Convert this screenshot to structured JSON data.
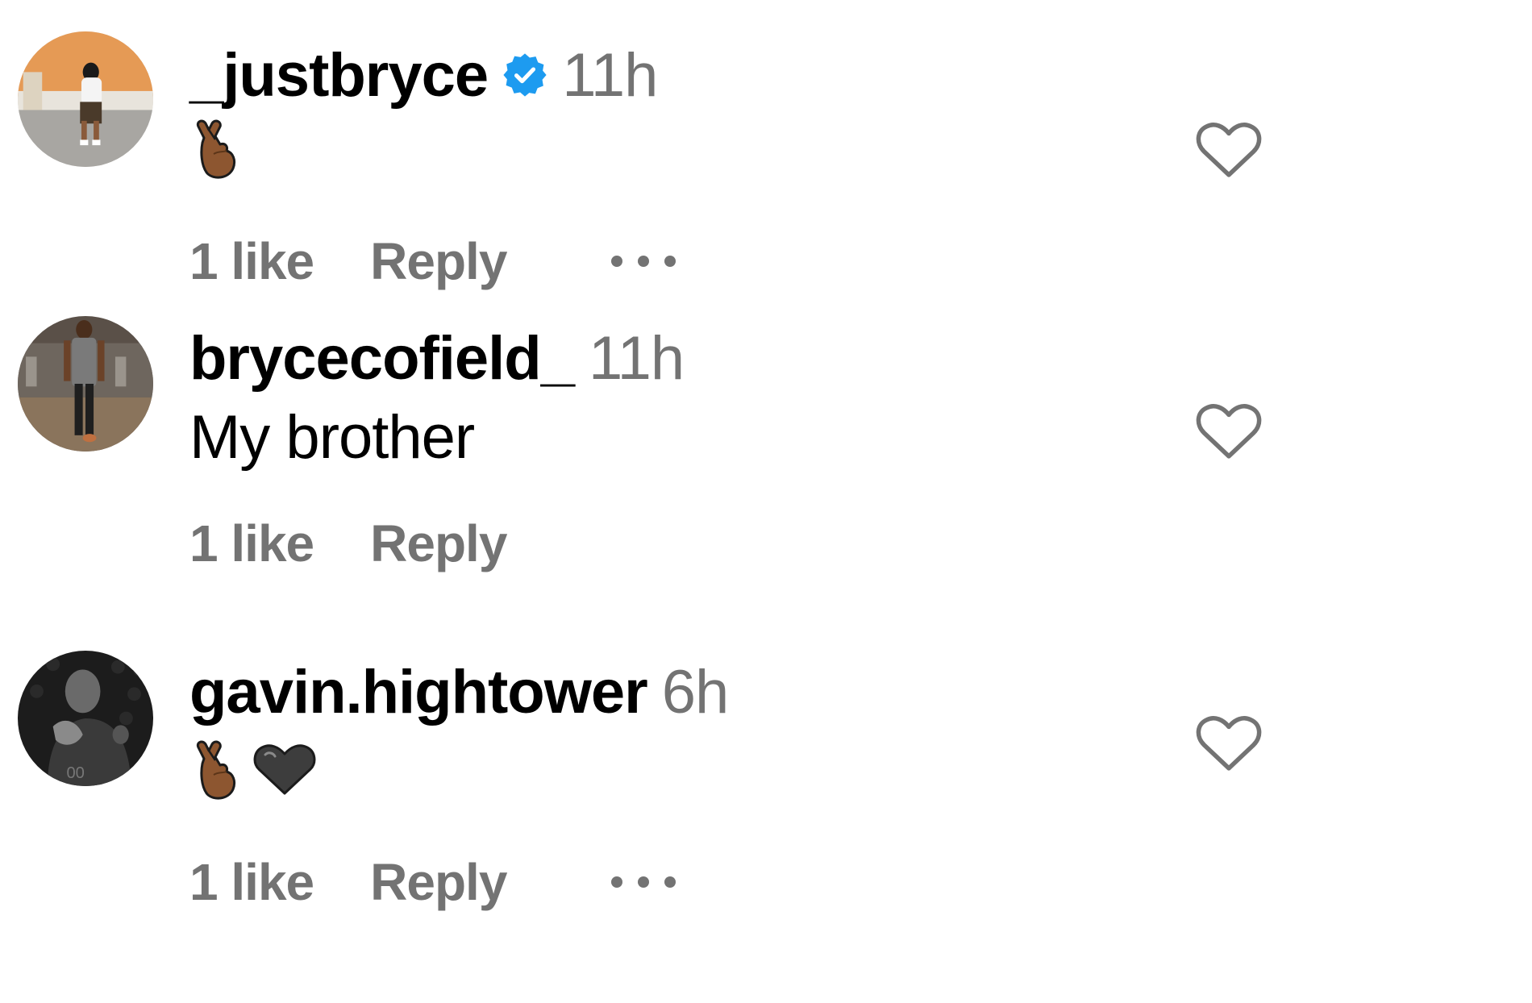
{
  "colors": {
    "username": "#000000",
    "secondary_text": "#737373",
    "verified_badge": "#1d9bf0",
    "like_icon_stroke": "#737373"
  },
  "comments": [
    {
      "username": "_justbryce",
      "verified": true,
      "time": "11h",
      "body_text": "",
      "emojis": [
        "crossed-fingers-medium-dark"
      ],
      "likes_label": "1 like",
      "reply_label": "Reply",
      "has_more_menu": true,
      "avatar_icon": "avatar-photo-person-seated-orange-wall"
    },
    {
      "username": "brycecofield_",
      "verified": false,
      "time": "11h",
      "body_text": "My brother",
      "emojis": [],
      "likes_label": "1 like",
      "reply_label": "Reply",
      "has_more_menu": false,
      "avatar_icon": "avatar-photo-player-gym"
    },
    {
      "username": "gavin.hightower",
      "verified": false,
      "time": "6h",
      "body_text": "",
      "emojis": [
        "crossed-fingers-medium-dark",
        "black-heart"
      ],
      "likes_label": "1 like",
      "reply_label": "Reply",
      "has_more_menu": true,
      "avatar_icon": "avatar-photo-player-black-and-white"
    }
  ]
}
